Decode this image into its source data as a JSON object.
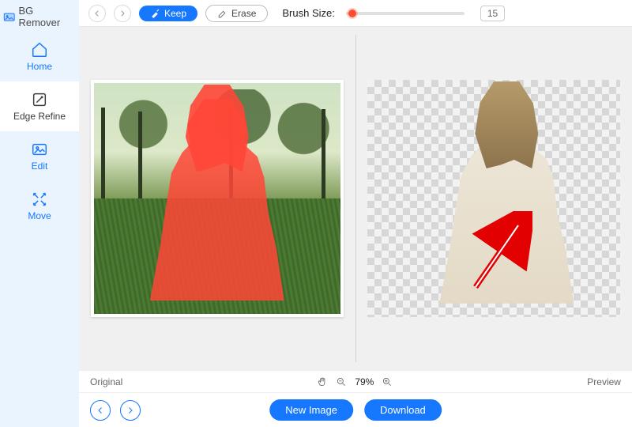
{
  "app": {
    "title": "BG Remover"
  },
  "sidebar": {
    "items": [
      {
        "label": "Home"
      },
      {
        "label": "Edge Refine"
      },
      {
        "label": "Edit"
      },
      {
        "label": "Move"
      }
    ]
  },
  "toolbar": {
    "keep_label": "Keep",
    "erase_label": "Erase",
    "brush_label": "Brush Size:",
    "brush_value": "15"
  },
  "status": {
    "left_label": "Original",
    "zoom_value": "79%",
    "right_label": "Preview"
  },
  "bottom": {
    "new_image_label": "New Image",
    "download_label": "Download"
  }
}
